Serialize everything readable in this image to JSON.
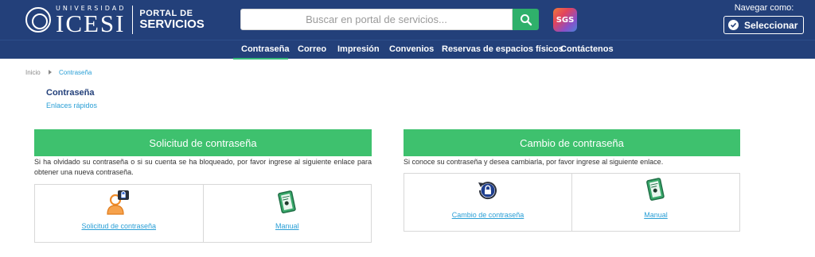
{
  "header": {
    "university_small": "UNIVERSIDAD",
    "university_big": "ICESI",
    "portal_top": "PORTAL DE",
    "portal_bottom": "SERVICIOS",
    "search_placeholder": "Buscar en portal de servicios...",
    "sgs_label": "SGS",
    "navigate_as_label": "Navegar como:",
    "select_button_label": "Seleccionar"
  },
  "nav": {
    "items": [
      {
        "label": "Contraseña"
      },
      {
        "label": "Correo"
      },
      {
        "label": "Impresión"
      },
      {
        "label": "Convenios"
      },
      {
        "label": "Reservas de espacios físicos"
      },
      {
        "label": "Contáctenos"
      }
    ]
  },
  "breadcrumb": {
    "home": "Inicio",
    "current": "Contraseña"
  },
  "page": {
    "title": "Contraseña",
    "quick_links": "Enlaces rápidos"
  },
  "panels": [
    {
      "title": "Solicitud de contraseña",
      "description": "Si ha olvidado su contraseña o si su cuenta se ha bloqueado, por favor ingrese al siguiente enlace para obtener una nueva contraseña.",
      "cards": [
        {
          "label": "Solicitud de contraseña",
          "icon": "user-lock-icon"
        },
        {
          "label": "Manual",
          "icon": "manual-book-icon"
        }
      ]
    },
    {
      "title": "Cambio de contraseña",
      "description": "Si conoce su contraseña y desea cambiarla, por favor ingrese al siguiente enlace.",
      "cards": [
        {
          "label": "Cambio de contraseña",
          "icon": "lock-refresh-icon"
        },
        {
          "label": "Manual",
          "icon": "manual-book-icon"
        }
      ]
    }
  ],
  "colors": {
    "header_bg": "#23407a",
    "accent_green": "#3ec16e",
    "link_blue": "#2a9fd6"
  }
}
